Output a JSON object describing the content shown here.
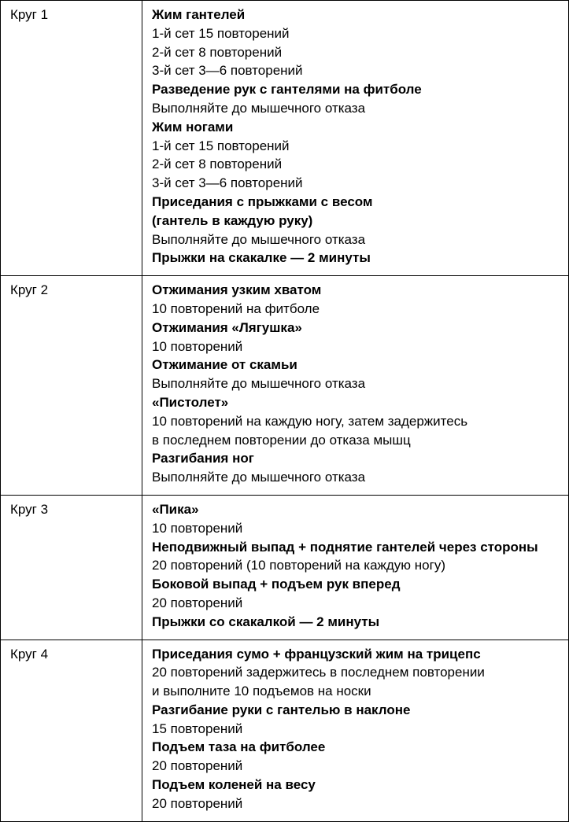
{
  "rows": [
    {
      "label": "Круг 1",
      "lines": [
        {
          "text": "Жим гантелей",
          "bold": true
        },
        {
          "text": "1-й сет 15 повторений",
          "bold": false
        },
        {
          "text": "2-й сет 8 повторений",
          "bold": false
        },
        {
          "text": "3-й сет 3—6 повторений",
          "bold": false
        },
        {
          "text": "Разведение рук с гантелями на фитболе",
          "bold": true
        },
        {
          "text": "Выполняйте до мышечного отказа",
          "bold": false
        },
        {
          "text": "Жим ногами",
          "bold": true
        },
        {
          "text": "1-й сет 15 повторений",
          "bold": false
        },
        {
          "text": "2-й сет 8 повторений",
          "bold": false
        },
        {
          "text": "3-й сет 3—6 повторений",
          "bold": false
        },
        {
          "text": "Приседания с прыжками с весом",
          "bold": true
        },
        {
          "text": "(гантель в каждую руку)",
          "bold": true
        },
        {
          "text": "Выполняйте до мышечного отказа",
          "bold": false
        },
        {
          "text": "Прыжки на скакалке — 2 минуты",
          "bold": true
        }
      ]
    },
    {
      "label": "Круг 2",
      "lines": [
        {
          "text": "Отжимания узким хватом",
          "bold": true
        },
        {
          "text": "10 повторений на фитболе",
          "bold": false
        },
        {
          "text": "Отжимания «Лягушка»",
          "bold": true
        },
        {
          "text": "10 повторений",
          "bold": false
        },
        {
          "text": "Отжимание от скамьи",
          "bold": true
        },
        {
          "text": "Выполняйте до мышечного отказа",
          "bold": false
        },
        {
          "text": "«Пистолет»",
          "bold": true
        },
        {
          "text": "10 повторений на каждую ногу, затем задержитесь",
          "bold": false
        },
        {
          "text": "в последнем повторении до отказа мышц",
          "bold": false
        },
        {
          "text": "Разгибания ног",
          "bold": true
        },
        {
          "text": "Выполняйте до мышечного отказа",
          "bold": false
        }
      ]
    },
    {
      "label": "Круг 3",
      "lines": [
        {
          "text": "«Пика»",
          "bold": true
        },
        {
          "text": "10 повторений",
          "bold": false
        },
        {
          "text": "Неподвижный выпад + поднятие гантелей через стороны",
          "bold": true
        },
        {
          "text": "20 повторений (10 повторений на каждую ногу)",
          "bold": false
        },
        {
          "text": "Боковой выпад + подъем рук вперед",
          "bold": true
        },
        {
          "text": "20 повторений",
          "bold": false
        },
        {
          "text": "Прыжки со скакалкой — 2 минуты",
          "bold": true
        }
      ]
    },
    {
      "label": "Круг 4",
      "lines": [
        {
          "text": "Приседания сумо + французский жим на трицепс",
          "bold": true
        },
        {
          "text": "20 повторений задержитесь в последнем повторении",
          "bold": false
        },
        {
          "text": "и выполните 10 подъемов на носки",
          "bold": false
        },
        {
          "text": "Разгибание руки с гантелью в наклоне",
          "bold": true
        },
        {
          "text": "15 повторений",
          "bold": false
        },
        {
          "text": "Подъем таза на фитболее",
          "bold": true
        },
        {
          "text": "20 повторений",
          "bold": false
        },
        {
          "text": "Подъем коленей на весу",
          "bold": true
        },
        {
          "text": "20 повторений",
          "bold": false
        }
      ]
    }
  ]
}
